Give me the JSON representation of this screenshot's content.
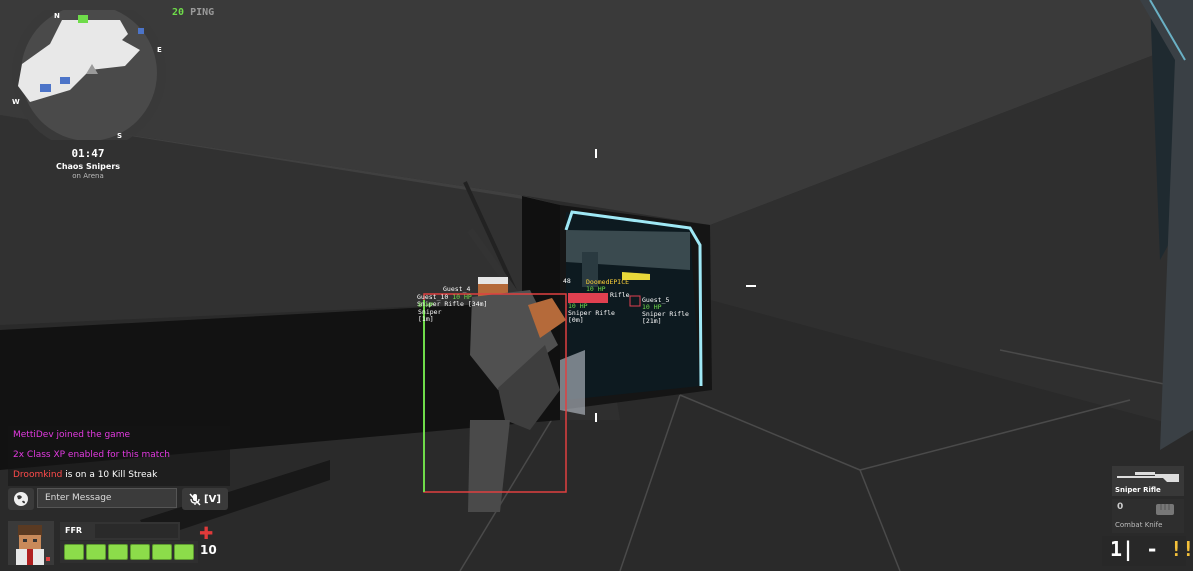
{
  "hud": {
    "ping_value": "20",
    "ping_label": "PING",
    "timer": "01:47",
    "mode": "Chaos Snipers",
    "map": "on Arena",
    "compass": {
      "n": "N",
      "e": "E",
      "s": "S",
      "w": "W"
    }
  },
  "chat": {
    "messages": [
      {
        "name": "MettiDev",
        "text": "MettiDev joined the game",
        "color": "#e23ae0"
      },
      {
        "name": "",
        "text": "2x Class XP enabled for this match",
        "color": "#e23ae0"
      },
      {
        "name": "Droomkind",
        "text": " is on a 10 Kill Streak",
        "color": "#ff4b4b"
      }
    ],
    "input_placeholder": "Enter Message",
    "voice_key": "[V]",
    "globe_icon": "globe-icon",
    "mute_icon": "mic-off-icon"
  },
  "player": {
    "team": "FFR",
    "health": "10",
    "health_segments": 6,
    "health_color": "#8cdc4a"
  },
  "loadout": {
    "primary_name": "Sniper Rifle",
    "primary_slot": "",
    "secondary_name": "Combat Knife",
    "secondary_slot": "0",
    "ammo_clip": "1",
    "ammo_sep": "|",
    "ammo_dash": "-",
    "ammo_reserve": "!!!"
  },
  "nametags": [
    {
      "name": "Guest_4",
      "hp": "",
      "weapon": "",
      "dist": ""
    },
    {
      "name": "Guest_10",
      "hp": "10 HP",
      "weapon": "Sniper Rifle",
      "dist": "[34m]"
    },
    {
      "name": "",
      "hp": "8 HP",
      "weapon": "Sniper",
      "dist": "[1m]"
    },
    {
      "name": "DoomedEPICE",
      "hp": "10 HP",
      "weapon": "",
      "dist": ""
    },
    {
      "name": "",
      "hp": "10 HP",
      "weapon": "Sniper Rifle",
      "dist": "[0m]"
    },
    {
      "name": "Guest_5",
      "hp": "10 HP",
      "weapon": "Sniper Rifle",
      "dist": "[21m]"
    },
    {
      "name": "",
      "hp": "",
      "weapon": "Rifle",
      "dist": ""
    },
    {
      "name": "48",
      "hp": "",
      "weapon": "",
      "dist": ""
    }
  ]
}
